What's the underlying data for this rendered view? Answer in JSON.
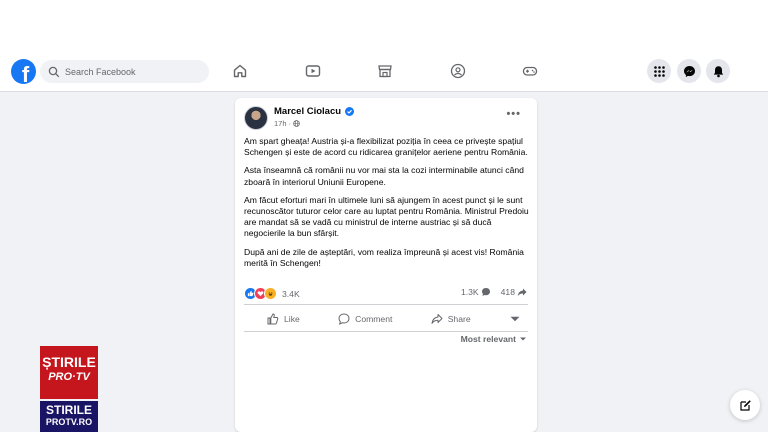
{
  "navbar": {
    "logo_letter": "f",
    "search_placeholder": "Search Facebook",
    "nav_icons": [
      "home-icon",
      "video-icon",
      "marketplace-icon",
      "groups-icon",
      "gaming-icon"
    ],
    "right_icons": [
      "menu-grid-icon",
      "messenger-icon",
      "notifications-icon"
    ]
  },
  "post": {
    "author": "Marcel Ciolacu",
    "time": "17h",
    "paragraphs": [
      "Am spart gheața! Austria și-a flexibilizat poziția în ceea ce privește spațiul Schengen și este de acord cu ridicarea granițelor aeriene pentru România.",
      "Asta înseamnă că românii nu vor mai sta la cozi interminabile atunci când zboară în interiorul Uniunii Europene.",
      "Am făcut eforturi mari în ultimele luni să ajungem în acest punct și le sunt recunoscător tuturor celor care au luptat pentru România. Ministrul Predoiu are mandat să se vadă cu ministrul de interne austriac și să ducă negocierile la bun sfârșit.",
      "După ani de zile de așteptări, vom realiza împreună și acest vis! România merită în Schengen!"
    ],
    "reactions_count": "3.4K",
    "comments_count": "1.3K",
    "shares_count": "418",
    "actions": {
      "like": "Like",
      "comment": "Comment",
      "share": "Share"
    },
    "sort_label": "Most relevant"
  },
  "watermark": {
    "top_line1": "ȘTIRILE",
    "top_line2": "PRO·TV",
    "bottom_line1": "STIRILE",
    "bottom_line2": "PROTV.RO"
  },
  "colors": {
    "brand": "#1877f2",
    "background": "#f0f2f5",
    "watermark_red": "#c4161c",
    "watermark_blue": "#1a1464"
  }
}
